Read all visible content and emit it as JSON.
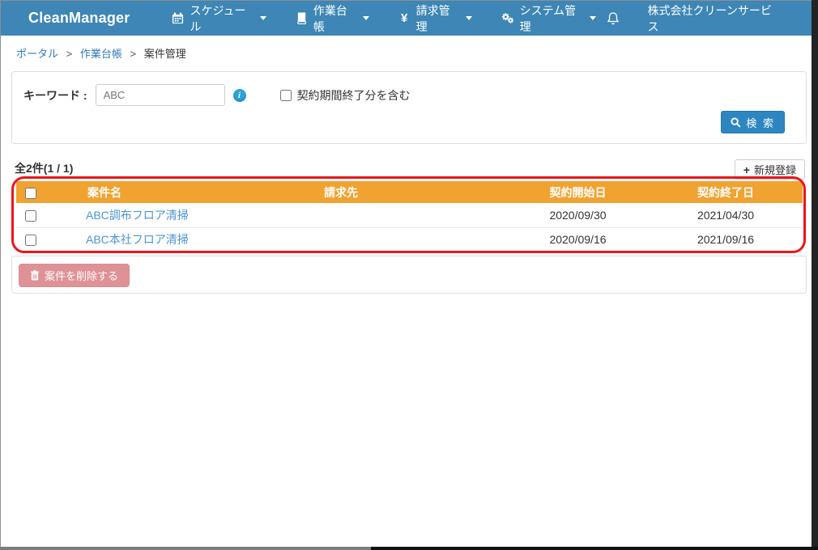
{
  "navbar": {
    "brand": "CleanManager",
    "menus": [
      {
        "label": "スケジュール",
        "icon": "calendar-icon"
      },
      {
        "label": "作業台帳",
        "icon": "book-icon"
      },
      {
        "label": "請求管理",
        "icon": "yen-icon",
        "glyph": "¥"
      },
      {
        "label": "システム管理",
        "icon": "gears-icon"
      }
    ],
    "company": "株式会社クリーンサービス"
  },
  "breadcrumb": {
    "separator": ">",
    "items": [
      {
        "label": "ポータル"
      },
      {
        "label": "作業台帳"
      },
      {
        "label": "案件管理"
      }
    ]
  },
  "search": {
    "keyword_label": "キーワード :",
    "keyword_value": "ABC",
    "info_glyph": "i",
    "checkbox_label": "契約期間終了分を含む",
    "search_button_label": "検 索"
  },
  "results": {
    "count_text": "全2件(1 / 1)",
    "new_button_plus": "+",
    "new_button_label": "新規登録"
  },
  "table": {
    "headers": [
      "案件名",
      "請求先",
      "契約開始日",
      "契約終了日"
    ],
    "rows": [
      {
        "name": "ABC調布フロア清掃",
        "billing": "",
        "start": "2020/09/30",
        "end": "2021/04/30"
      },
      {
        "name": "ABC本社フロア清掃",
        "billing": "",
        "start": "2020/09/16",
        "end": "2021/09/16"
      }
    ]
  },
  "actions": {
    "delete_button_label": "案件を削除する"
  },
  "colors": {
    "navbar_blue": "#3d86b6",
    "search_button_blue": "#2e86c1",
    "table_header_orange": "#f0a330",
    "link_blue": "#4e94d4",
    "breadcrumb_link_blue": "#337ab7",
    "delete_button_pink": "#df9296",
    "annotation_red": "#e8151d"
  }
}
